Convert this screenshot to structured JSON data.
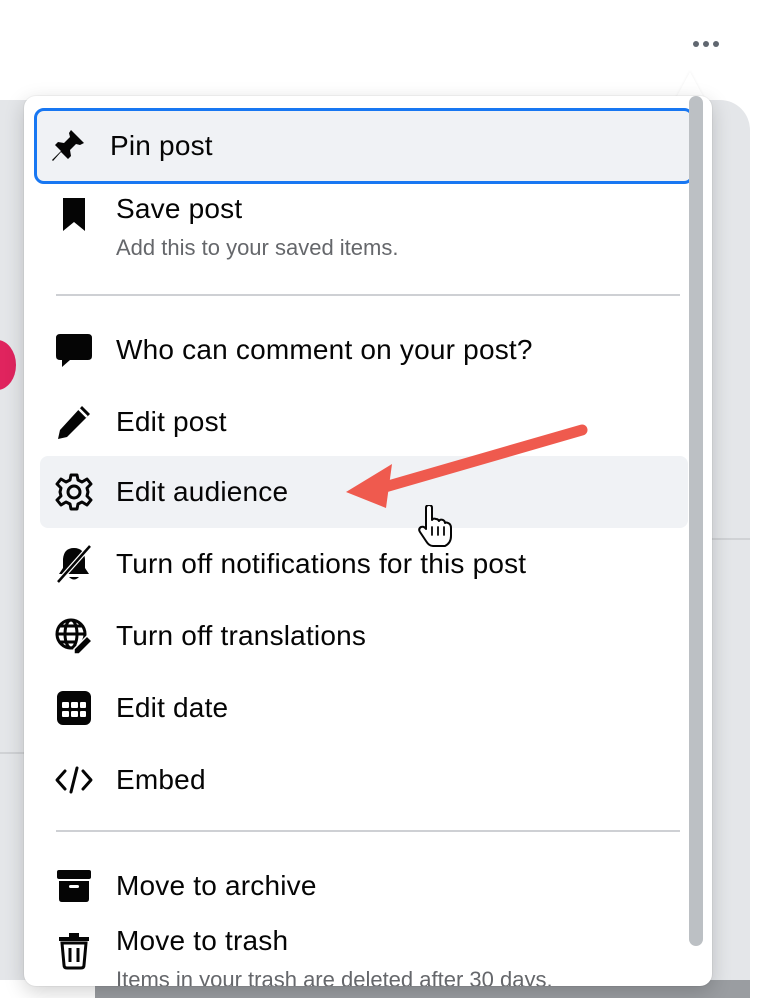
{
  "header": {
    "more_icon": "more-horizontal-icon"
  },
  "menu": {
    "items": [
      {
        "label": "Pin post",
        "icon": "pin-icon"
      },
      {
        "label": "Save post",
        "sublabel": "Add this to your saved items.",
        "icon": "bookmark-icon"
      },
      {
        "label": "Who can comment on your post?",
        "icon": "comment-icon"
      },
      {
        "label": "Edit post",
        "icon": "pencil-icon"
      },
      {
        "label": "Edit audience",
        "icon": "gear-icon"
      },
      {
        "label": "Turn off notifications for this post",
        "icon": "bell-off-icon"
      },
      {
        "label": "Turn off translations",
        "icon": "globe-edit-icon"
      },
      {
        "label": "Edit date",
        "icon": "calendar-icon"
      },
      {
        "label": "Embed",
        "icon": "code-icon"
      },
      {
        "label": "Move to archive",
        "icon": "archive-icon"
      },
      {
        "label": "Move to trash",
        "sublabel": "Items in your trash are deleted after 30 days.",
        "icon": "trash-icon"
      }
    ]
  },
  "colors": {
    "focus_ring": "#1877f2",
    "annotation_arrow": "#ef5a4e",
    "text_primary": "#050505",
    "text_secondary": "#65676b"
  }
}
